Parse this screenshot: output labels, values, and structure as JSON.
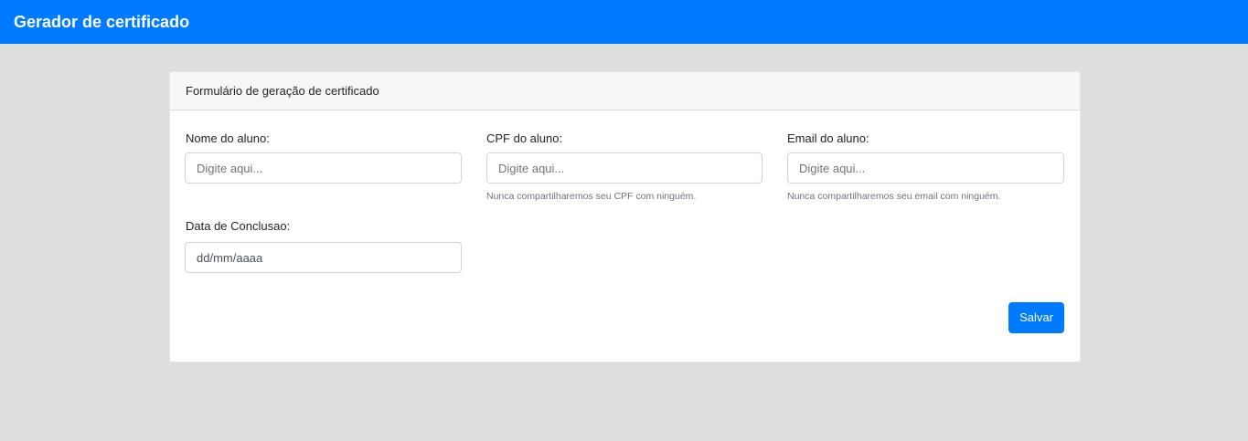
{
  "navbar": {
    "brand": "Gerador de certificado"
  },
  "card": {
    "header": "Formulário de geração de certificado"
  },
  "form": {
    "nome": {
      "label": "Nome do aluno:",
      "placeholder": "Digite aqui...",
      "value": ""
    },
    "cpf": {
      "label": "CPF do aluno:",
      "placeholder": "Digite aqui...",
      "value": "",
      "help": "Nunca compartilharemos seu CPF com ninguém."
    },
    "email": {
      "label": "Email do aluno:",
      "placeholder": "Digite aqui...",
      "value": "",
      "help": "Nunca compartilharemos seu email com ninguém."
    },
    "data": {
      "label": "Data de Conclusao:",
      "value": "dd/mm/aaaa"
    },
    "submit_label": "Salvar"
  },
  "colors": {
    "primary": "#007bff",
    "background": "#dedede",
    "card_header": "#f7f7f7",
    "muted_text": "#6c757d"
  }
}
